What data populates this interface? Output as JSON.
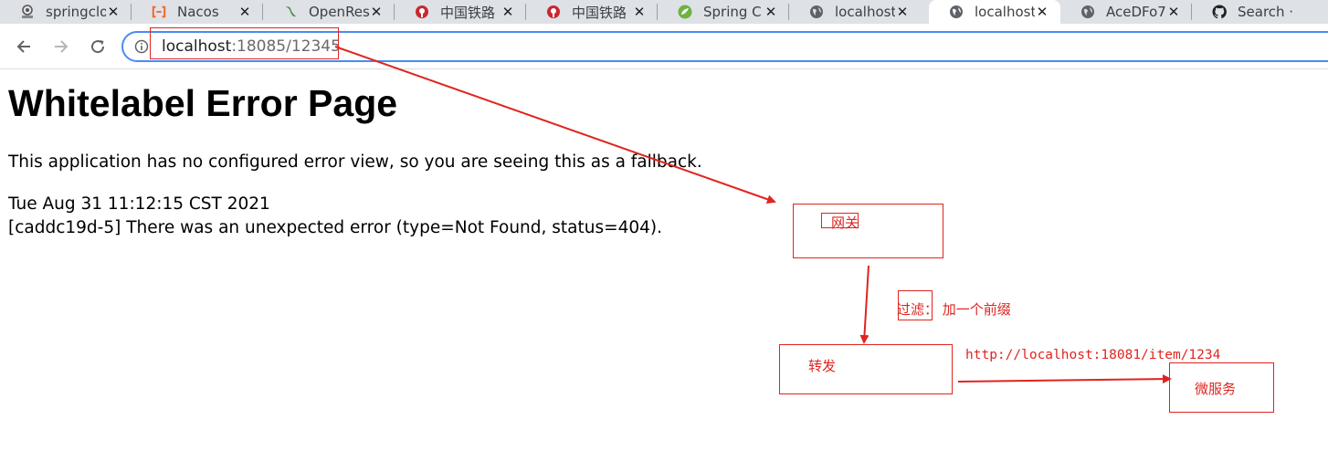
{
  "browser": {
    "tabs": [
      {
        "label": "springclo",
        "icon": "site-logo-icon",
        "active": false
      },
      {
        "label": "Nacos",
        "icon": "nacos-icon",
        "active": false
      },
      {
        "label": "OpenRes",
        "icon": "openresty-icon",
        "active": false
      },
      {
        "label": "中国铁路",
        "icon": "railway-icon",
        "active": false
      },
      {
        "label": "中国铁路",
        "icon": "railway-icon",
        "active": false
      },
      {
        "label": "Spring C",
        "icon": "spring-icon",
        "active": false
      },
      {
        "label": "localhost",
        "icon": "globe-icon",
        "active": false
      },
      {
        "label": "localhost",
        "icon": "globe-icon",
        "active": true
      },
      {
        "label": "AceDFo7",
        "icon": "globe-icon",
        "active": false
      },
      {
        "label": "Search · ",
        "icon": "github-icon",
        "active": false
      }
    ],
    "close_glyph": "✕",
    "url_host": "localhost",
    "url_rest": ":18085/12345"
  },
  "page": {
    "title": "Whitelabel Error Page",
    "message": "This application has no configured error view, so you are seeing this as a fallback.",
    "timestamp": "Tue Aug 31 11:12:15 CST 2021",
    "error": "[caddc19d-5] There was an unexpected error (type=Not Found, status=404)."
  },
  "annotations": {
    "gateway": "网关",
    "filter": "过滤：  加一个前缀",
    "forward": "转发",
    "url": "http://localhost:18081/item/1234",
    "microservice": "微服务",
    "color": "#e0241f"
  }
}
